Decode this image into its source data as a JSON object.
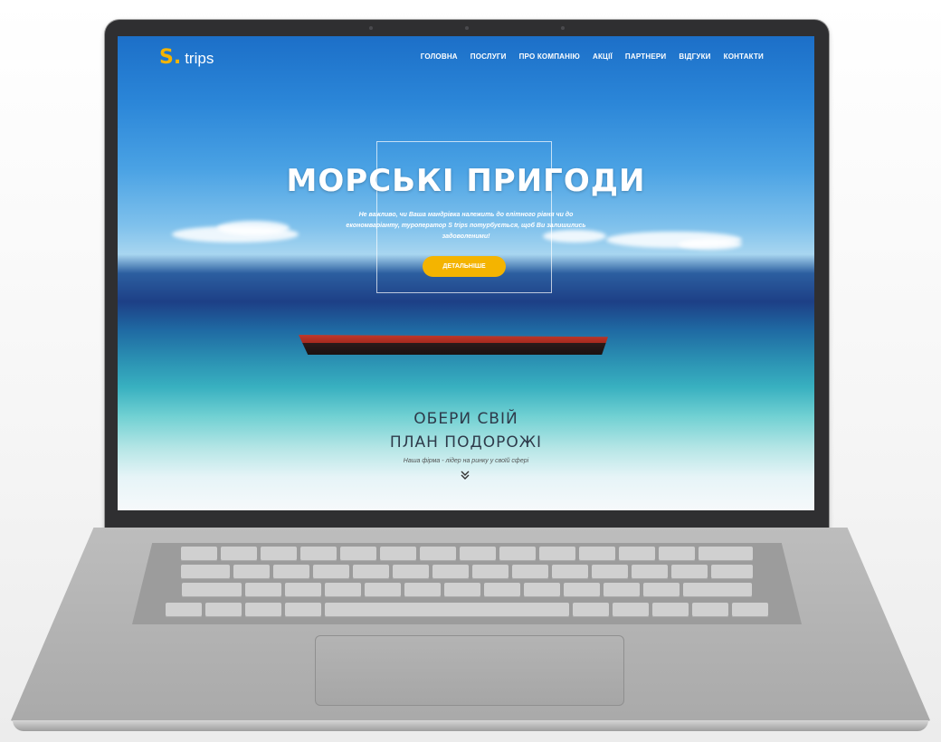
{
  "site": {
    "logo_mark": "S.",
    "logo_text": "trips",
    "nav": {
      "items": [
        "ГОЛОВНА",
        "ПОСЛУГИ",
        "ПРО КОМПАНІЮ",
        "АКЦІЇ",
        "ПАРТНЕРИ",
        "ВІДГУКИ",
        "КОНТАКТИ"
      ]
    },
    "hero": {
      "title": "МОРСЬКІ ПРИГОДИ",
      "subtitle": "Не важливо, чи Ваша мандрівка належить до елітного рівня чи до економваріанту, туроператор S trips потурбується, щоб Ви залишились задоволеними!",
      "cta_label": "ДЕТАЛЬНІШЕ"
    },
    "plan": {
      "title_line1": "ОБЕРИ СВІЙ",
      "title_line2": "ПЛАН ПОДОРОЖІ",
      "subtitle": "Наша фірма - лідер на ринку у своїй сфері"
    }
  },
  "icons": {
    "scroll": "chevron-double-down-icon"
  },
  "colors": {
    "accent": "#f4b400",
    "nav_text": "#ffffff",
    "plan_text": "#2e3a4a"
  }
}
